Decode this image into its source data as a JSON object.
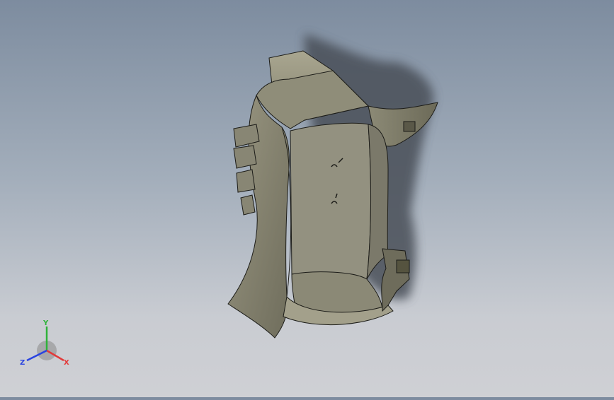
{
  "viewport": {
    "background_top": "#7d8c9f",
    "background_bottom": "#cfd0d4",
    "model_face_color": "#7e7c6a",
    "model_edge_color": "#1c1c18",
    "shadow_color": "#4a4f58"
  },
  "triad": {
    "x_label": "X",
    "y_label": "Y",
    "z_label": "Z",
    "x_color": "#e23a3a",
    "y_color": "#2fb23a",
    "z_color": "#2a44e0"
  }
}
